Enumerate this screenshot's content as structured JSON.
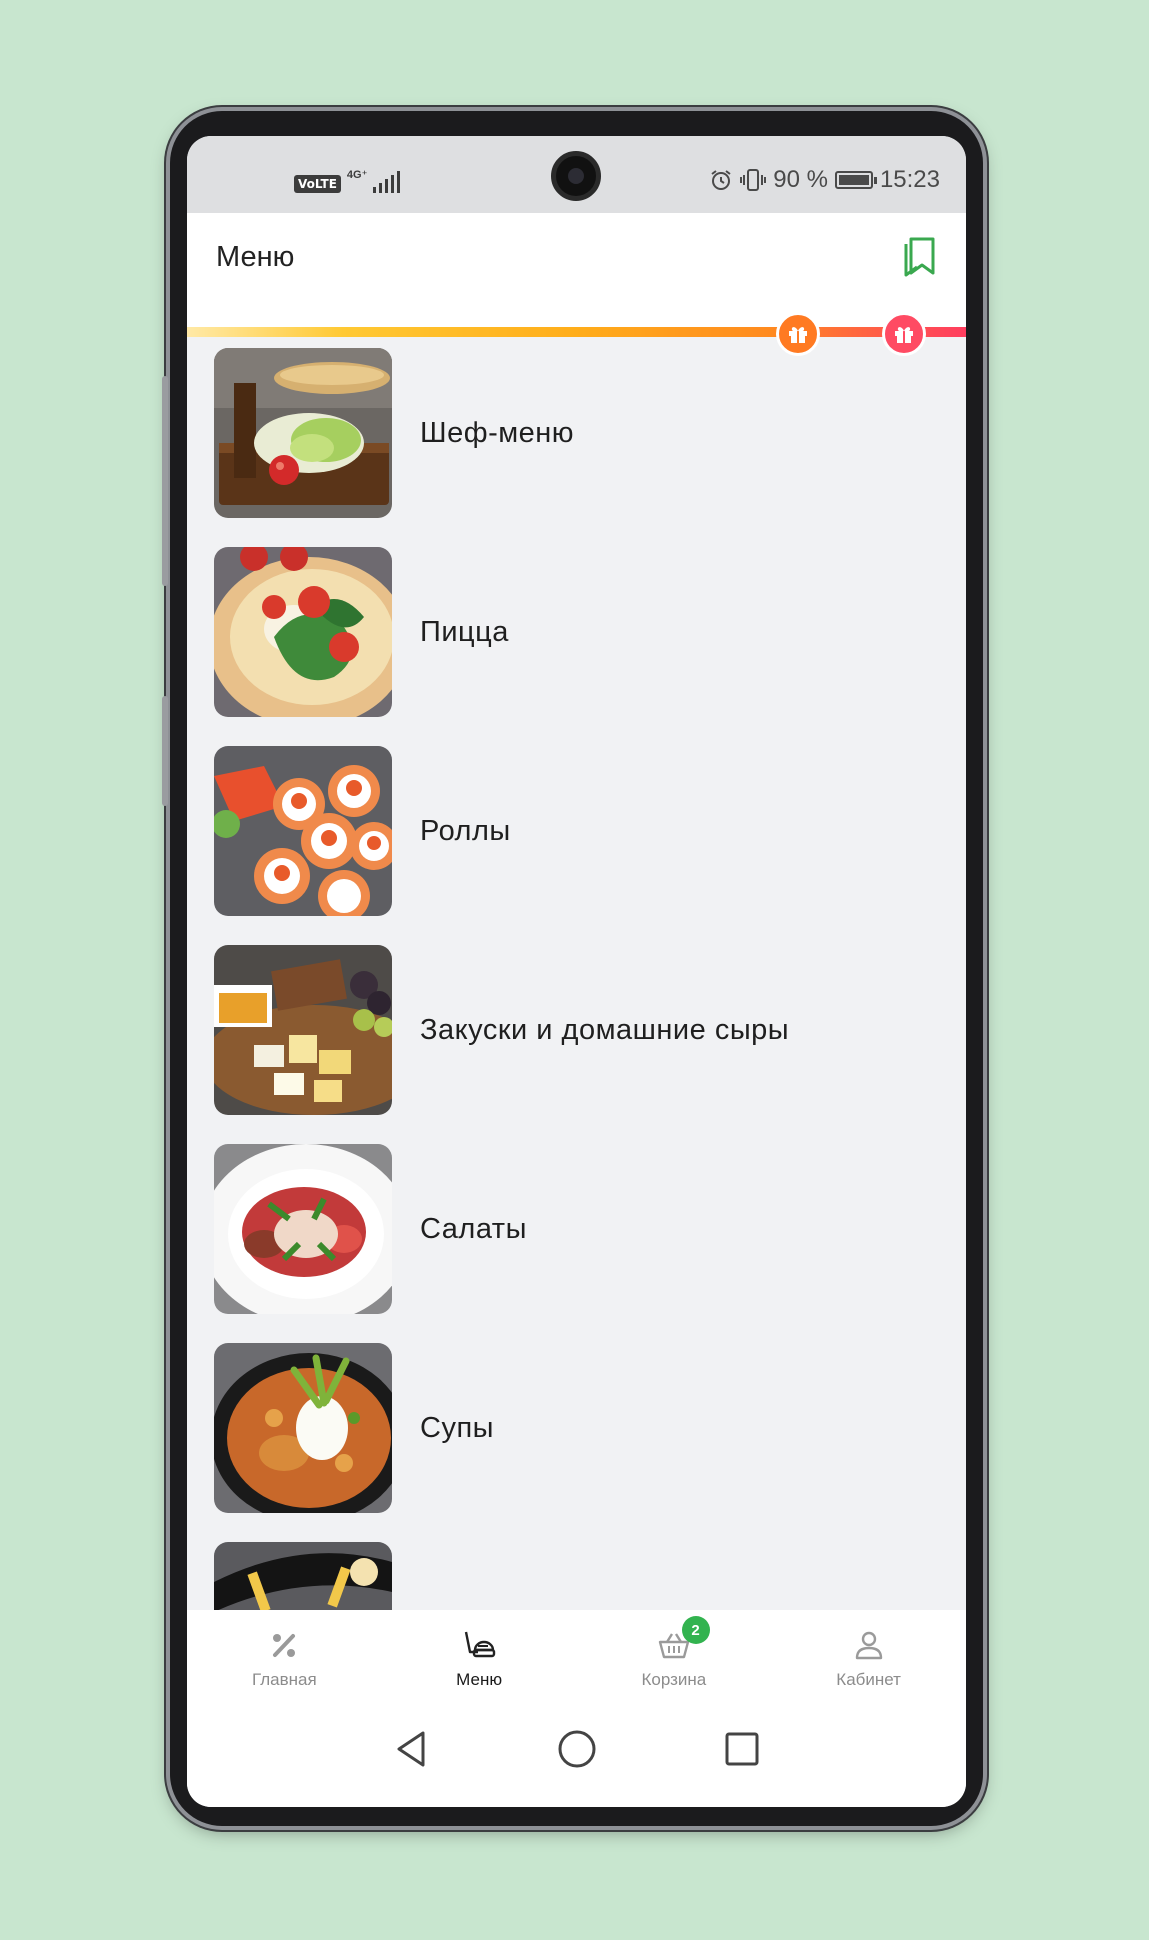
{
  "status_bar": {
    "volte": "VoLTE",
    "network": "4G⁺",
    "battery_text": "90 %",
    "time": "15:23"
  },
  "header": {
    "title": "Меню",
    "bookmark_icon": "bookmark-icon"
  },
  "progress": {
    "gift_icons": [
      "gift-icon",
      "gift-icon"
    ],
    "colors": [
      "#ffc933",
      "#ff8a1f",
      "#ff3d5f"
    ]
  },
  "menu": {
    "items": [
      {
        "label": "Шеф-меню",
        "image": "chef-menu-image"
      },
      {
        "label": "Пицца",
        "image": "pizza-image"
      },
      {
        "label": "Роллы",
        "image": "rolls-image"
      },
      {
        "label": "Закуски и домашние сыры",
        "image": "snacks-cheese-image"
      },
      {
        "label": "Салаты",
        "image": "salads-image"
      },
      {
        "label": "Супы",
        "image": "soups-image"
      },
      {
        "label": "",
        "image": "next-category-image"
      }
    ]
  },
  "bottom_nav": {
    "tabs": [
      {
        "label": "Главная",
        "icon": "percent-icon",
        "active": false
      },
      {
        "label": "Меню",
        "icon": "menu-icon",
        "active": true
      },
      {
        "label": "Корзина",
        "icon": "basket-icon",
        "active": false,
        "badge": "2"
      },
      {
        "label": "Кабинет",
        "icon": "user-icon",
        "active": false
      }
    ],
    "badge_color": "#32b34f"
  },
  "system_nav": {
    "buttons": [
      "back-icon",
      "home-icon",
      "recents-icon"
    ]
  }
}
